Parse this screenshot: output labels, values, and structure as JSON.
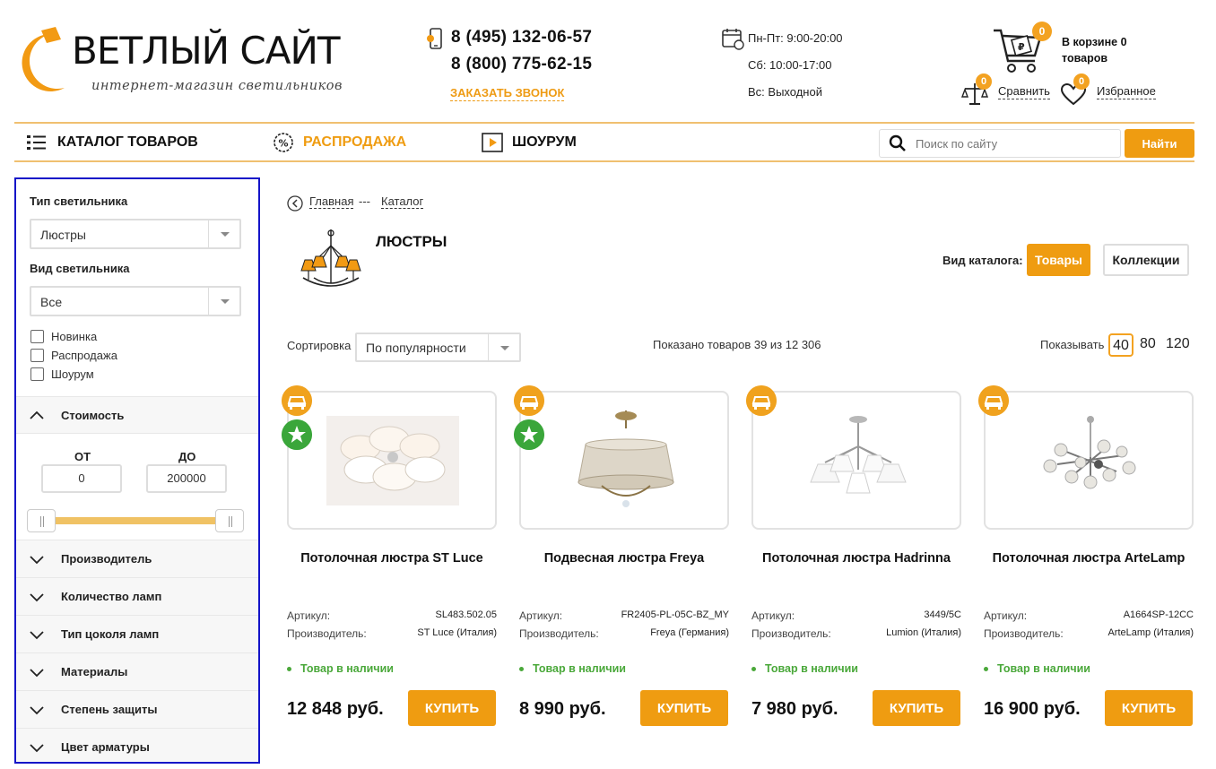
{
  "header": {
    "logo_text": "ВЕТЛЫЙ САЙТ",
    "logo_sub": "интернет-магазин светильников",
    "phone1": "8 (495) 132-06-57",
    "phone2": "8 (800) 775-62-15",
    "callback": "ЗАКАЗАТЬ ЗВОНОК",
    "schedule": [
      "Пн-Пт: 9:00-20:00",
      "Сб: 10:00-17:00",
      "Вс: Выходной"
    ],
    "cart_count": "0",
    "cart_text": "В корзине 0 товаров",
    "compare_count": "0",
    "compare_label": "Сравнить",
    "fav_count": "0",
    "fav_label": "Избранное",
    "accent_color": "#ef9c11"
  },
  "nav": {
    "catalog": "КАТАЛОГ ТОВАРОВ",
    "sale": "РАСПРОДАЖА",
    "showroom": "ШОУРУМ",
    "search_placeholder": "Поиск по сайту",
    "search_button": "Найти"
  },
  "sidebar": {
    "type_label": "Тип светильника",
    "type_value": "Люстры",
    "kind_label": "Вид светильника",
    "kind_value": "Все",
    "checkboxes": [
      "Новинка",
      "Распродажа",
      "Шоурум"
    ],
    "price_label": "Стоимость",
    "from_label": "ОТ",
    "to_label": "ДО",
    "price_from": "0",
    "price_to": "200000",
    "sections": [
      "Производитель",
      "Количество ламп",
      "Тип цоколя ламп",
      "Материалы",
      "Степень защиты",
      "Цвет арматуры"
    ]
  },
  "main": {
    "breadcrumbs": [
      "Главная",
      "---",
      "Каталог"
    ],
    "title": "ЛЮСТРЫ",
    "view_label": "Вид каталога:",
    "view_goods": "Товары",
    "view_collections": "Коллекции",
    "sort_label": "Сортировка",
    "sort_value": "По популярности",
    "shown_text": "Показано товаров 39 из 12 306",
    "per_page_label": "Показывать",
    "per_page": [
      "40",
      "80",
      "120"
    ]
  },
  "products": [
    {
      "name": "Потолочная люстра ST Luce",
      "article_label": "Артикул:",
      "article": "SL483.502.05",
      "maker_label": "Производитель:",
      "maker": "ST Luce (Италия)",
      "stock": "Товар в наличии",
      "price": "12 848 руб.",
      "buy": "КУПИТЬ",
      "star": true
    },
    {
      "name": "Подвесная люстра Freya",
      "article_label": "Артикул:",
      "article": "FR2405-PL-05C-BZ_MY",
      "maker_label": "Производитель:",
      "maker": "Freya (Германия)",
      "stock": "Товар в наличии",
      "price": "8 990 руб.",
      "buy": "КУПИТЬ",
      "star": true
    },
    {
      "name": "Потолочная люстра Hadrinna",
      "article_label": "Артикул:",
      "article": "3449/5C",
      "maker_label": "Производитель:",
      "maker": "Lumion (Италия)",
      "stock": "Товар в наличии",
      "price": "7 980 руб.",
      "buy": "КУПИТЬ",
      "star": false
    },
    {
      "name": "Потолочная люстра ArteLamp",
      "article_label": "Артикул:",
      "article": "A1664SP-12CC",
      "maker_label": "Производитель:",
      "maker": "ArteLamp (Италия)",
      "stock": "Товар в наличии",
      "price": "16 900 руб.",
      "buy": "КУПИТЬ",
      "star": false
    }
  ]
}
